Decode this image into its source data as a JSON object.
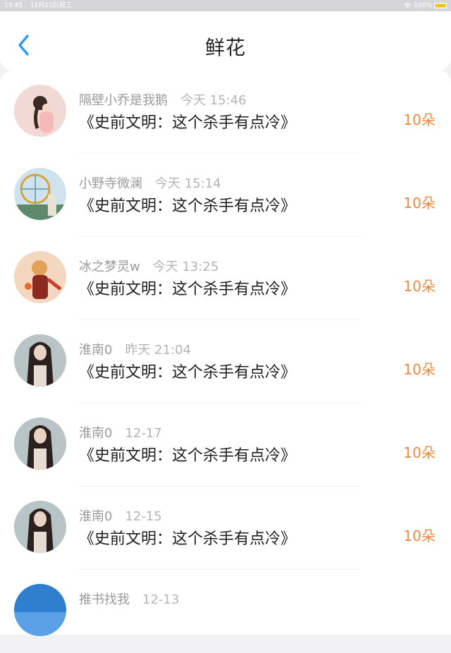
{
  "status": {
    "time": "19:45",
    "date": "12月21日周三",
    "battery": "100%"
  },
  "nav": {
    "title": "鲜花"
  },
  "items": [
    {
      "name": "隔壁小乔是我鹅",
      "time": "今天 15:46",
      "book": "《史前文明：这个杀手有点冷》",
      "count": "10朵"
    },
    {
      "name": "小野寺微澜",
      "time": "今天 15:14",
      "book": "《史前文明：这个杀手有点冷》",
      "count": "10朵"
    },
    {
      "name": "冰之梦灵w",
      "time": "今天 13:25",
      "book": "《史前文明：这个杀手有点冷》",
      "count": "10朵"
    },
    {
      "name": "淮南0",
      "time": "昨天 21:04",
      "book": "《史前文明：这个杀手有点冷》",
      "count": "10朵"
    },
    {
      "name": "淮南0",
      "time": "12-17",
      "book": "《史前文明：这个杀手有点冷》",
      "count": "10朵"
    },
    {
      "name": "淮南0",
      "time": "12-15",
      "book": "《史前文明：这个杀手有点冷》",
      "count": "10朵"
    },
    {
      "name": "推书找我",
      "time": "12-13",
      "book": "",
      "count": ""
    }
  ],
  "colors": {
    "accent": "#2e9bf0",
    "count": "#f0883a"
  }
}
